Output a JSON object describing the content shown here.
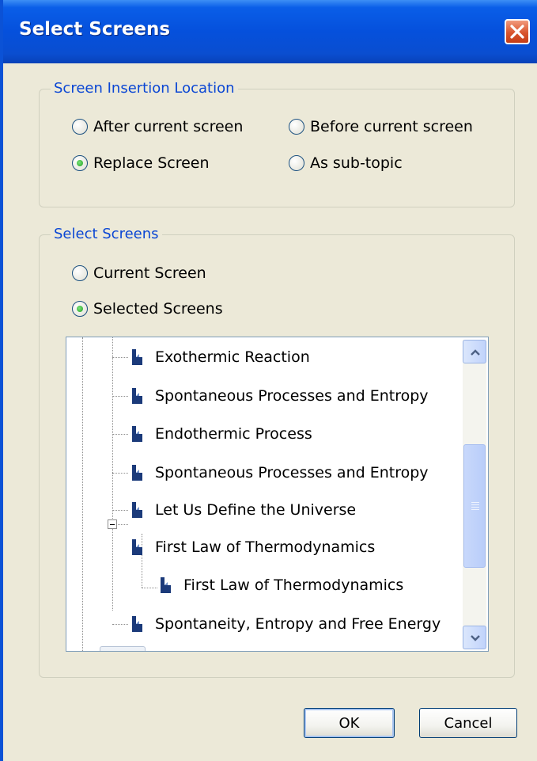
{
  "dialog": {
    "title": "Select Screens"
  },
  "insertion_group": {
    "legend": "Screen Insertion Location",
    "options": [
      {
        "label": "After current screen",
        "checked": false
      },
      {
        "label": "Before current screen",
        "checked": false
      },
      {
        "label": "Replace Screen",
        "checked": true
      },
      {
        "label": "As sub-topic",
        "checked": false
      }
    ]
  },
  "select_group": {
    "legend": "Select Screens",
    "options": [
      {
        "label": "Current Screen",
        "checked": false
      },
      {
        "label": "Selected Screens",
        "checked": true
      }
    ]
  },
  "tree": {
    "items": [
      {
        "label": "Exothermic Reaction",
        "level": 1
      },
      {
        "label": "Spontaneous Processes and Entropy",
        "level": 1
      },
      {
        "label": "Endothermic Process",
        "level": 1
      },
      {
        "label": "Spontaneous Processes and Entropy",
        "level": 1
      },
      {
        "label": "Let Us Define the Universe",
        "level": 1
      },
      {
        "label": "First Law of Thermodynamics",
        "level": 1,
        "expanded": true
      },
      {
        "label": "First Law of Thermodynamics",
        "level": 2
      },
      {
        "label": "Spontaneity, Entropy and Free Energy",
        "level": 1
      }
    ]
  },
  "buttons": {
    "ok": "OK",
    "cancel": "Cancel"
  },
  "icons": {
    "close": "close-icon",
    "doc": "document-icon",
    "scroll_up": "arrow-up-icon",
    "scroll_down": "arrow-down-icon"
  },
  "colors": {
    "titlebar": "#0550dc",
    "group_legend": "#0a46d4",
    "doc_icon": "#1b3a7a"
  }
}
